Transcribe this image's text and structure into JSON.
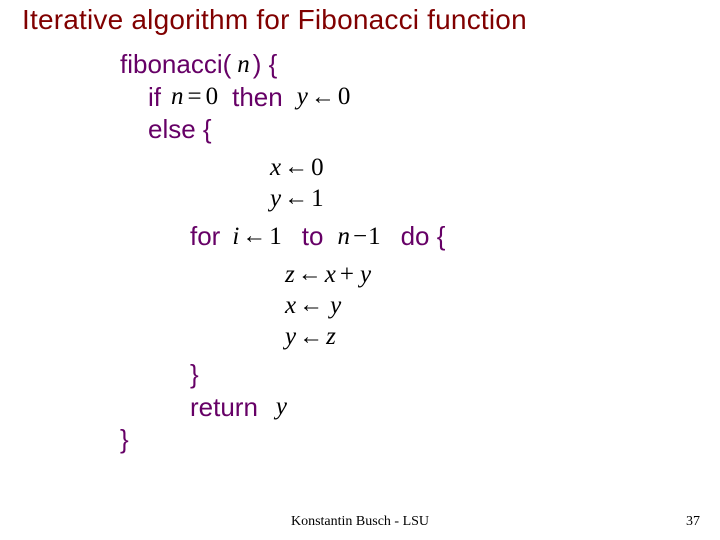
{
  "title": "Iterative algorithm for Fibonacci function",
  "kw": {
    "fname": "fibonacci(",
    "paren_brace": ") {",
    "if": "if",
    "then": "then",
    "else_brace": "else {",
    "for": "for",
    "to": "to",
    "do_brace": "do {",
    "close_brace": "}",
    "return": "return"
  },
  "math": {
    "n": "n",
    "eq0_lhs": "n",
    "eq0_op": "=",
    "eq0_rhs": "0",
    "y0_l": "y",
    "y0_r": "0",
    "x0_l": "x",
    "x0_r": "0",
    "y1_l": "y",
    "y1_r": "1",
    "i1_l": "i",
    "i1_r": "1",
    "nm1_a": "n",
    "nm1_op": "−",
    "nm1_b": "1",
    "zxy_l": "z",
    "zxy_a": "x",
    "zxy_op": "+",
    "zxy_b": "y",
    "xy_l": "x",
    "xy_r": "y",
    "yz_l": "y",
    "yz_r": "z",
    "rety": "y"
  },
  "footer": {
    "center": "Konstantin Busch - LSU",
    "page": "37"
  }
}
